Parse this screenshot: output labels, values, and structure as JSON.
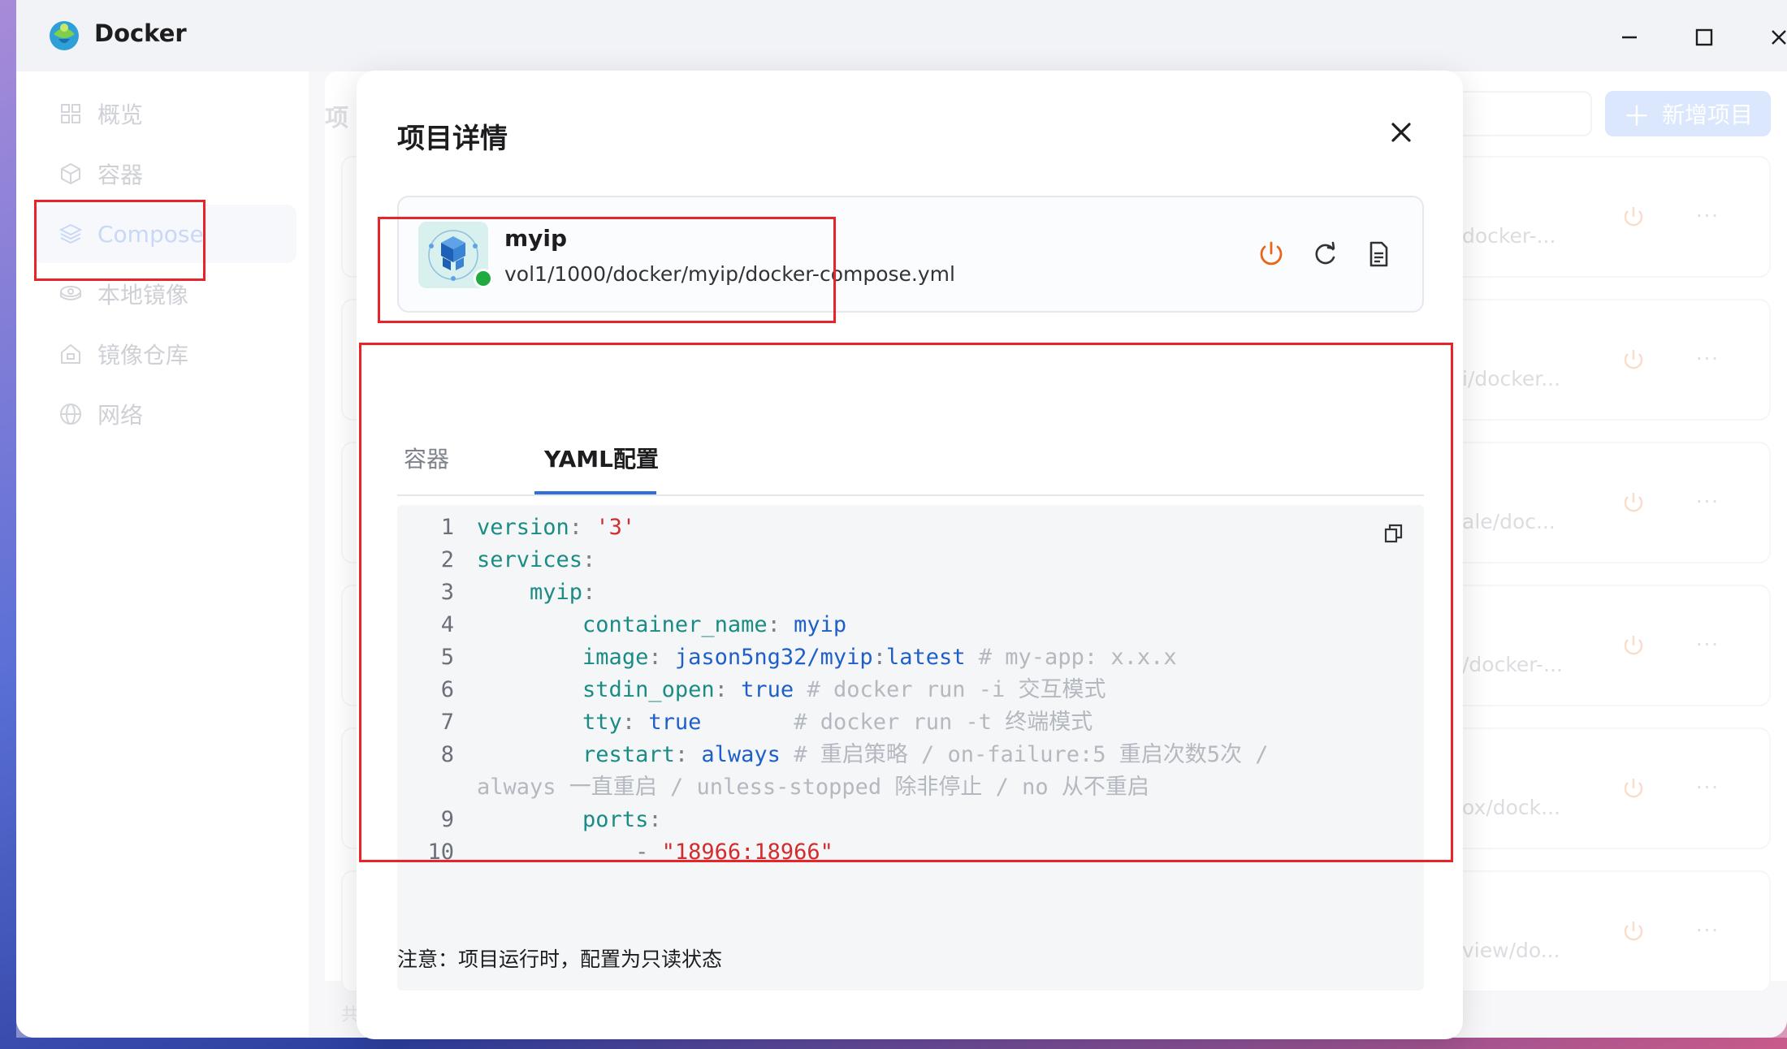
{
  "app": {
    "title": "Docker"
  },
  "sidebar": {
    "items": [
      {
        "label": "概览",
        "icon": "grid-icon"
      },
      {
        "label": "容器",
        "icon": "cube-icon"
      },
      {
        "label": "Compose",
        "icon": "layers-icon",
        "active": true
      },
      {
        "label": "本地镜像",
        "icon": "disk-icon"
      },
      {
        "label": "镜像仓库",
        "icon": "warehouse-icon"
      },
      {
        "label": "网络",
        "icon": "globe-icon"
      }
    ]
  },
  "main": {
    "title_fragment": "项",
    "add_button": "新增项目",
    "footer_fragment": "共",
    "projects_paths": [
      "docker-...",
      "i/docker...",
      "ale/doc...",
      "/docker-...",
      "ox/dock...",
      "view/do..."
    ],
    "more_label": "···"
  },
  "modal": {
    "title": "项目详情",
    "project": {
      "name": "myip",
      "path": "vol1/1000/docker/myip/docker-compose.yml",
      "status": "running"
    },
    "tabs": [
      {
        "label": "容器",
        "active": false
      },
      {
        "label": "YAML配置",
        "active": true
      }
    ],
    "note": "注意：项目运行时，配置为只读状态"
  },
  "yaml": {
    "lines": [
      {
        "num": "1",
        "indent": "",
        "key": "version",
        "value": "'3'",
        "value_type": "string",
        "comment": ""
      },
      {
        "num": "2",
        "indent": "",
        "key": "services",
        "value": "",
        "value_type": "",
        "comment": ""
      },
      {
        "num": "3",
        "indent": "    ",
        "key": "myip",
        "value": "",
        "value_type": "",
        "comment": ""
      },
      {
        "num": "4",
        "indent": "        ",
        "key": "container_name",
        "value": "myip",
        "value_type": "plain",
        "comment": ""
      },
      {
        "num": "5",
        "indent": "        ",
        "key": "image",
        "value": "jason5ng32/myip:latest",
        "value_type": "plain",
        "comment": "# my-app: x.x.x"
      },
      {
        "num": "6",
        "indent": "        ",
        "key": "stdin_open",
        "value": "true",
        "value_type": "plain",
        "comment": "# docker run -i 交互模式"
      },
      {
        "num": "7",
        "indent": "        ",
        "key": "tty",
        "value": "true",
        "value_type": "plain",
        "comment": "# docker run -t 终端模式",
        "pad": "       "
      },
      {
        "num": "8",
        "indent": "        ",
        "key": "restart",
        "value": "always",
        "value_type": "plain",
        "comment": "# 重启策略 / on-failure:5 重启次数5次 /"
      },
      {
        "num": "",
        "indent": "",
        "key": "",
        "value": "",
        "value_type": "",
        "comment": "always 一直重启 / unless-stopped 除非停止 / no 从不重启"
      },
      {
        "num": "9",
        "indent": "        ",
        "key": "ports",
        "value": "",
        "value_type": "",
        "comment": ""
      },
      {
        "num": "10",
        "indent": "            ",
        "key": "",
        "value": "\"18966:18966\"",
        "value_type": "string",
        "comment": "",
        "dash": true
      }
    ]
  },
  "colors": {
    "accent": "#2e6fdb",
    "running": "#1fab3f",
    "power_orange": "#e8651c",
    "annotation_red": "#e8242a"
  }
}
